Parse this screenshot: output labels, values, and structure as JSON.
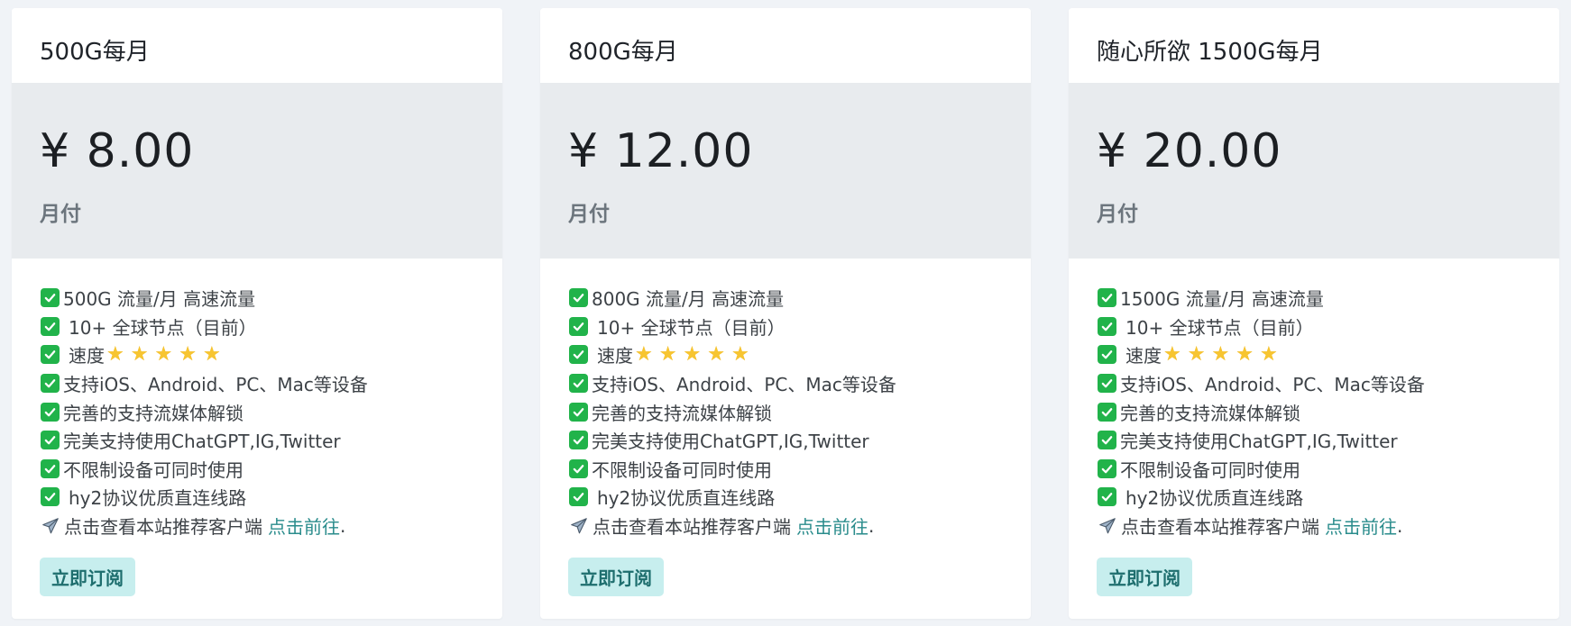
{
  "plans": [
    {
      "title": "500G每月",
      "price": "¥ 8.00",
      "period": "月付",
      "features": {
        "traffic": "500G 流量/月 高速流量",
        "nodes": "10+ 全球节点（目前）",
        "speed": "速度",
        "devices": "支持iOS、Android、PC、Mac等设备",
        "streaming": "完善的支持流媒体解锁",
        "apps": "完美支持使用ChatGPT,IG,Twitter",
        "unlimited": "不限制设备可同时使用",
        "protocol": "hy2协议优质直连线路"
      },
      "client_text": "点击查看本站推荐客户端",
      "client_link": "点击前往",
      "client_dot": ".",
      "subscribe": "立即订阅"
    },
    {
      "title": "800G每月",
      "price": "¥ 12.00",
      "period": "月付",
      "features": {
        "traffic": "800G 流量/月 高速流量",
        "nodes": "10+ 全球节点（目前）",
        "speed": "速度",
        "devices": "支持iOS、Android、PC、Mac等设备",
        "streaming": "完善的支持流媒体解锁",
        "apps": "完美支持使用ChatGPT,IG,Twitter",
        "unlimited": "不限制设备可同时使用",
        "protocol": "hy2协议优质直连线路"
      },
      "client_text": "点击查看本站推荐客户端",
      "client_link": "点击前往",
      "client_dot": ".",
      "subscribe": "立即订阅"
    },
    {
      "title": "随心所欲 1500G每月",
      "price": "¥ 20.00",
      "period": "月付",
      "features": {
        "traffic": "1500G 流量/月 高速流量",
        "nodes": "10+ 全球节点（目前）",
        "speed": "速度",
        "devices": "支持iOS、Android、PC、Mac等设备",
        "streaming": "完善的支持流媒体解锁",
        "apps": "完美支持使用ChatGPT,IG,Twitter",
        "unlimited": "不限制设备可同时使用",
        "protocol": "hy2协议优质直连线路"
      },
      "client_text": "点击查看本站推荐客户端",
      "client_link": "点击前往",
      "client_dot": ".",
      "subscribe": "立即订阅"
    }
  ],
  "speed_rating": 5,
  "icons": {
    "check": "check-box-icon",
    "star": "star-icon",
    "plane": "airplane-icon"
  },
  "colors": {
    "check_green": "#21b34a",
    "star_yellow": "#f7c531",
    "link_teal": "#2a8c8c",
    "button_bg": "#c7eeee",
    "button_text": "#1e6e6e",
    "price_bg": "#e8ebee"
  }
}
